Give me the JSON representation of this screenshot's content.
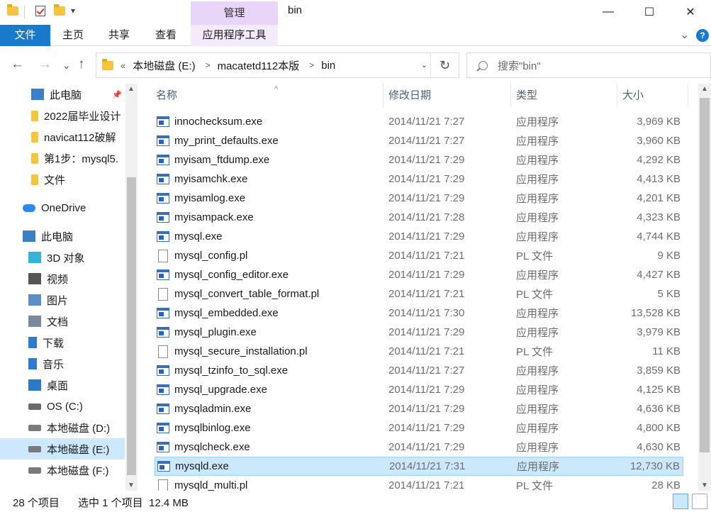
{
  "window": {
    "title": "bin",
    "context_tab": "管理",
    "minimize": "—",
    "maximize": "☐",
    "close": "✕"
  },
  "ribbon": {
    "tabs": [
      "文件",
      "主页",
      "共享",
      "查看",
      "应用程序工具"
    ],
    "expand_glyph": "⌄",
    "help_glyph": "?"
  },
  "nav": {
    "back": "←",
    "forward": "→",
    "recent": "⌄",
    "up": "↑",
    "overflow": "«",
    "breadcrumbs": [
      "本地磁盘 (E:)",
      "macatetd112本版",
      "bin"
    ],
    "refresh": "↻",
    "search_placeholder": "搜索\"bin\""
  },
  "sidebar": {
    "items": [
      {
        "label": "此电脑",
        "icon": "pc-icon",
        "pinned": true
      },
      {
        "label": "2022届毕业设计",
        "icon": "folder-icon"
      },
      {
        "label": "navicat112破解",
        "icon": "folder-icon"
      },
      {
        "label": "第1步：mysql5.",
        "icon": "folder-icon"
      },
      {
        "label": "文件",
        "icon": "folder-icon"
      },
      {
        "label": "OneDrive",
        "icon": "cloud-icon"
      },
      {
        "label": "此电脑",
        "icon": "pc-icon"
      },
      {
        "label": "3D 对象",
        "icon": "cube-icon"
      },
      {
        "label": "视频",
        "icon": "video-icon"
      },
      {
        "label": "图片",
        "icon": "picture-icon"
      },
      {
        "label": "文档",
        "icon": "document-icon"
      },
      {
        "label": "下载",
        "icon": "download-icon"
      },
      {
        "label": "音乐",
        "icon": "music-icon"
      },
      {
        "label": "桌面",
        "icon": "desktop-icon"
      },
      {
        "label": "OS (C:)",
        "icon": "os-drive-icon"
      },
      {
        "label": "本地磁盘 (D:)",
        "icon": "drive-icon"
      },
      {
        "label": "本地磁盘 (E:)",
        "icon": "drive-icon",
        "selected": true
      },
      {
        "label": "本地磁盘 (F:)",
        "icon": "drive-icon"
      }
    ]
  },
  "columns": {
    "name": "名称",
    "date": "修改日期",
    "type": "类型",
    "size": "大小",
    "sort_glyph": "^"
  },
  "files": [
    {
      "name": "innochecksum.exe",
      "date": "2014/11/21 7:27",
      "type": "应用程序",
      "size": "3,969 KB",
      "icon": "exe"
    },
    {
      "name": "my_print_defaults.exe",
      "date": "2014/11/21 7:27",
      "type": "应用程序",
      "size": "3,960 KB",
      "icon": "exe"
    },
    {
      "name": "myisam_ftdump.exe",
      "date": "2014/11/21 7:29",
      "type": "应用程序",
      "size": "4,292 KB",
      "icon": "exe"
    },
    {
      "name": "myisamchk.exe",
      "date": "2014/11/21 7:29",
      "type": "应用程序",
      "size": "4,413 KB",
      "icon": "exe"
    },
    {
      "name": "myisamlog.exe",
      "date": "2014/11/21 7:29",
      "type": "应用程序",
      "size": "4,201 KB",
      "icon": "exe"
    },
    {
      "name": "myisampack.exe",
      "date": "2014/11/21 7:28",
      "type": "应用程序",
      "size": "4,323 KB",
      "icon": "exe"
    },
    {
      "name": "mysql.exe",
      "date": "2014/11/21 7:29",
      "type": "应用程序",
      "size": "4,744 KB",
      "icon": "exe"
    },
    {
      "name": "mysql_config.pl",
      "date": "2014/11/21 7:21",
      "type": "PL 文件",
      "size": "9 KB",
      "icon": "doc"
    },
    {
      "name": "mysql_config_editor.exe",
      "date": "2014/11/21 7:29",
      "type": "应用程序",
      "size": "4,427 KB",
      "icon": "exe"
    },
    {
      "name": "mysql_convert_table_format.pl",
      "date": "2014/11/21 7:21",
      "type": "PL 文件",
      "size": "5 KB",
      "icon": "doc"
    },
    {
      "name": "mysql_embedded.exe",
      "date": "2014/11/21 7:30",
      "type": "应用程序",
      "size": "13,528 KB",
      "icon": "exe"
    },
    {
      "name": "mysql_plugin.exe",
      "date": "2014/11/21 7:29",
      "type": "应用程序",
      "size": "3,979 KB",
      "icon": "exe"
    },
    {
      "name": "mysql_secure_installation.pl",
      "date": "2014/11/21 7:21",
      "type": "PL 文件",
      "size": "11 KB",
      "icon": "doc"
    },
    {
      "name": "mysql_tzinfo_to_sql.exe",
      "date": "2014/11/21 7:27",
      "type": "应用程序",
      "size": "3,859 KB",
      "icon": "exe"
    },
    {
      "name": "mysql_upgrade.exe",
      "date": "2014/11/21 7:29",
      "type": "应用程序",
      "size": "4,125 KB",
      "icon": "exe"
    },
    {
      "name": "mysqladmin.exe",
      "date": "2014/11/21 7:29",
      "type": "应用程序",
      "size": "4,636 KB",
      "icon": "exe"
    },
    {
      "name": "mysqlbinlog.exe",
      "date": "2014/11/21 7:29",
      "type": "应用程序",
      "size": "4,800 KB",
      "icon": "exe"
    },
    {
      "name": "mysqlcheck.exe",
      "date": "2014/11/21 7:29",
      "type": "应用程序",
      "size": "4,630 KB",
      "icon": "exe"
    },
    {
      "name": "mysqld.exe",
      "date": "2014/11/21 7:31",
      "type": "应用程序",
      "size": "12,730 KB",
      "icon": "exe",
      "selected": true
    },
    {
      "name": "mysqld_multi.pl",
      "date": "2014/11/21 7:21",
      "type": "PL 文件",
      "size": "28 KB",
      "icon": "doc"
    }
  ],
  "status": {
    "count": "28 个项目",
    "selection": "选中 1 个项目  12.4 MB"
  },
  "colors": {
    "accent": "#1979ca",
    "selection": "#cce8ff",
    "context_tab": "#e8d5f8"
  }
}
